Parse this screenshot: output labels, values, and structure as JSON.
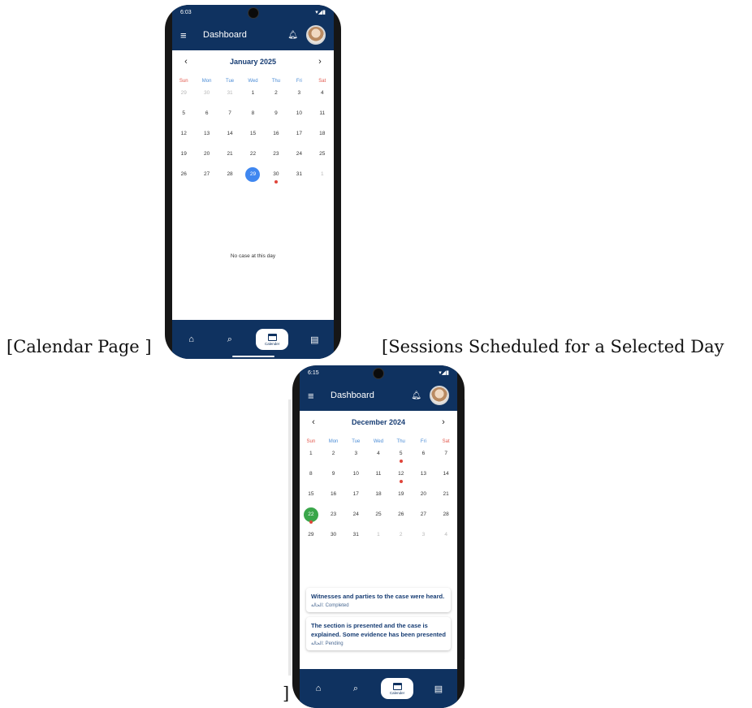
{
  "captions": {
    "left": "[Calendar Page ]",
    "right": "[Sessions Scheduled for a Selected Day",
    "close": "]"
  },
  "phone1": {
    "status_time": "6:03",
    "app_title": "Dashboard",
    "month_label": "January 2025",
    "weekdays": [
      "Sun",
      "Mon",
      "Tue",
      "Wed",
      "Thu",
      "Fri",
      "Sat"
    ],
    "days": [
      {
        "d": "29",
        "other": true
      },
      {
        "d": "30",
        "other": true
      },
      {
        "d": "31",
        "other": true
      },
      {
        "d": "1"
      },
      {
        "d": "2"
      },
      {
        "d": "3"
      },
      {
        "d": "4"
      },
      {
        "d": "5"
      },
      {
        "d": "6"
      },
      {
        "d": "7"
      },
      {
        "d": "8"
      },
      {
        "d": "9"
      },
      {
        "d": "10"
      },
      {
        "d": "11"
      },
      {
        "d": "12"
      },
      {
        "d": "13"
      },
      {
        "d": "14"
      },
      {
        "d": "15"
      },
      {
        "d": "16"
      },
      {
        "d": "17"
      },
      {
        "d": "18"
      },
      {
        "d": "19"
      },
      {
        "d": "20"
      },
      {
        "d": "21"
      },
      {
        "d": "22"
      },
      {
        "d": "23"
      },
      {
        "d": "24"
      },
      {
        "d": "25"
      },
      {
        "d": "26"
      },
      {
        "d": "27"
      },
      {
        "d": "28"
      },
      {
        "d": "29",
        "selected": "blue"
      },
      {
        "d": "30",
        "event": true
      },
      {
        "d": "31"
      },
      {
        "d": "1",
        "other": true
      }
    ],
    "empty_message": "No case at this day",
    "nav_active_label": "Calender"
  },
  "phone2": {
    "status_time": "6:15",
    "app_title": "Dashboard",
    "month_label": "December 2024",
    "weekdays": [
      "Sun",
      "Mon",
      "Tue",
      "Wed",
      "Thu",
      "Fri",
      "Sat"
    ],
    "days": [
      {
        "d": "1"
      },
      {
        "d": "2"
      },
      {
        "d": "3"
      },
      {
        "d": "4"
      },
      {
        "d": "5",
        "event": true
      },
      {
        "d": "6"
      },
      {
        "d": "7"
      },
      {
        "d": "8"
      },
      {
        "d": "9"
      },
      {
        "d": "10"
      },
      {
        "d": "11"
      },
      {
        "d": "12",
        "event": true
      },
      {
        "d": "13"
      },
      {
        "d": "14"
      },
      {
        "d": "15"
      },
      {
        "d": "16"
      },
      {
        "d": "17"
      },
      {
        "d": "18"
      },
      {
        "d": "19"
      },
      {
        "d": "20"
      },
      {
        "d": "21"
      },
      {
        "d": "22",
        "selected": "green",
        "event": true
      },
      {
        "d": "23"
      },
      {
        "d": "24"
      },
      {
        "d": "25"
      },
      {
        "d": "26"
      },
      {
        "d": "27"
      },
      {
        "d": "28"
      },
      {
        "d": "29"
      },
      {
        "d": "30"
      },
      {
        "d": "31"
      },
      {
        "d": "1",
        "other": true
      },
      {
        "d": "2",
        "other": true
      },
      {
        "d": "3",
        "other": true
      },
      {
        "d": "4",
        "other": true
      }
    ],
    "sessions": [
      {
        "title": "Witnesses and parties to the case were heard.",
        "status_label": "الحالة:",
        "status": "Completed"
      },
      {
        "title": "The section is presented and the case is explained. Some evidence has been presented",
        "status_label": "الحالة:",
        "status": "Pending"
      }
    ],
    "nav_active_label": "Calender"
  },
  "colors": {
    "primary": "#0f3260",
    "selected_blue": "#3f87f0",
    "selected_green": "#3aa64a",
    "event_dot": "#e0453a",
    "weekday_header": "#4b8cd6",
    "weekend_header": "#e2574c"
  }
}
